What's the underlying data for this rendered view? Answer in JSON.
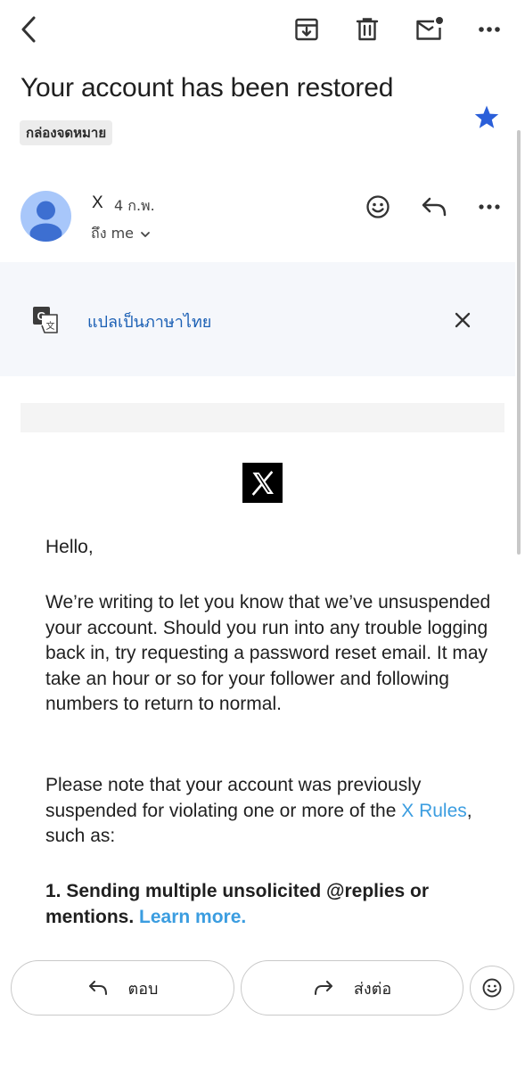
{
  "toolbar": {
    "back_icon": "chevron-left-icon",
    "archive_icon": "archive-icon",
    "delete_icon": "trash-icon",
    "mark_unread_icon": "mail-unread-icon",
    "more_icon": "more-horizontal-icon"
  },
  "email": {
    "subject": "Your account has been restored",
    "label": "กล่องจดหมาย",
    "starred": true,
    "star_color": "#2b5fd9"
  },
  "message": {
    "sender": "X",
    "date": "4 ก.พ.",
    "to": "ถึง me",
    "avatar_color": "#a8c7fa"
  },
  "translate": {
    "link": "แปลเป็นภาษาไทย",
    "link_color": "#1a5fb4"
  },
  "body": {
    "greeting": "Hello,",
    "para1": "We’re writing to let you know that we’ve unsuspended your account. Should you run into any trouble logging back in, try requesting a password reset email. It may take an hour or so for your follower and following numbers to return to normal.",
    "para2_prefix": "Please note that your account was previously suspended for violating one or more of the ",
    "para2_link": "X Rules",
    "para2_suffix": ", such as:",
    "item1_text": "1. Sending multiple unsolicited @replies or mentions. ",
    "item1_link": "Learn more.",
    "link_color": "#3b9de0"
  },
  "actions": {
    "reply": "ตอบ",
    "forward": "ส่งต่อ"
  }
}
